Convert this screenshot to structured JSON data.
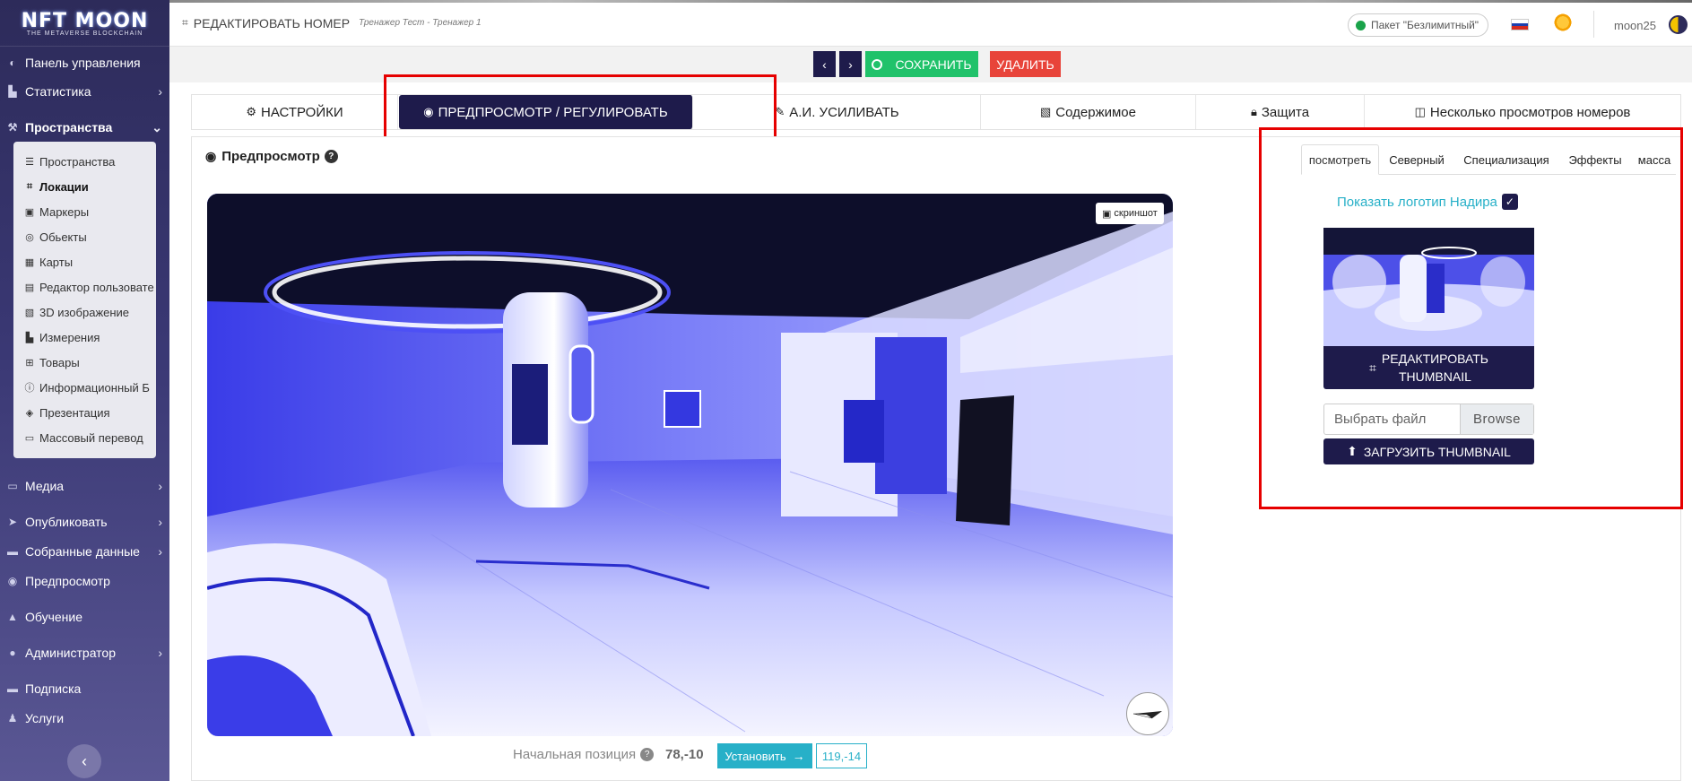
{
  "sidebar": {
    "logo": {
      "main": "NFT MOON",
      "sub": "THE METAVERSE BLOCKCHAIN"
    },
    "items": [
      {
        "label": "Панель управления"
      },
      {
        "label": "Статистика"
      },
      {
        "label": "Пространства"
      },
      {
        "label": "Медиа"
      },
      {
        "label": "Опубликовать"
      },
      {
        "label": "Собранные данные"
      },
      {
        "label": "Предпросмотр"
      },
      {
        "label": "Обучение"
      },
      {
        "label": "Администратор"
      },
      {
        "label": "Подписка"
      },
      {
        "label": "Услуги"
      }
    ],
    "submenu": [
      {
        "label": "Пространства"
      },
      {
        "label": "Локации"
      },
      {
        "label": "Маркеры"
      },
      {
        "label": "Обьекты"
      },
      {
        "label": "Карты"
      },
      {
        "label": "Редактор пользовате"
      },
      {
        "label": "3D изображение"
      },
      {
        "label": "Измерения"
      },
      {
        "label": "Товары"
      },
      {
        "label": "Информационный Б"
      },
      {
        "label": "Презентация"
      },
      {
        "label": "Массовый перевод"
      }
    ]
  },
  "header": {
    "title": "РЕДАКТИРОВАТЬ НОМЕР",
    "subtitle": "Тренажер Тест - Тренажер 1",
    "plan": "Пакет \"Безлимитный\"",
    "username": "moon25"
  },
  "actions": {
    "prev": "‹",
    "next": "›",
    "save": "СОХРАНИТЬ",
    "delete": "УДАЛИТЬ"
  },
  "tabs": [
    {
      "label": "НАСТРОЙКИ"
    },
    {
      "label": "ПРЕДПРОСМОТР / РЕГУЛИРОВАТЬ"
    },
    {
      "label": "А.И. УСИЛИВАТЬ"
    },
    {
      "label": "Содержимое"
    },
    {
      "label": "Защита"
    },
    {
      "label": "Несколько просмотров номеров"
    }
  ],
  "preview": {
    "title": "Предпросмотр",
    "help": "?",
    "screenshot": "скриншот",
    "start_label": "Начальная позиция",
    "start_value": "78,-10",
    "set_button": "Установить",
    "current_value": "119,-14"
  },
  "side": {
    "tabs": [
      {
        "label": "посмотреть"
      },
      {
        "label": "Северный"
      },
      {
        "label": "Специализация"
      },
      {
        "label": "Эффекты"
      },
      {
        "label": "масса"
      }
    ],
    "show_logo": "Показать логотип Надира",
    "edit_thumbnail_line1": "РЕДАКТИРОВАТЬ",
    "edit_thumbnail_line2": "THUMBNAIL",
    "file_placeholder": "Выбрать файл",
    "browse": "Browse",
    "upload": "ЗАГРУЗИТЬ THUMBNAIL"
  },
  "colors": {
    "primary": "#1e1b4b",
    "success": "#20c26a",
    "danger": "#e8443a",
    "info": "#27b0c8",
    "highlight": "#e60000"
  }
}
